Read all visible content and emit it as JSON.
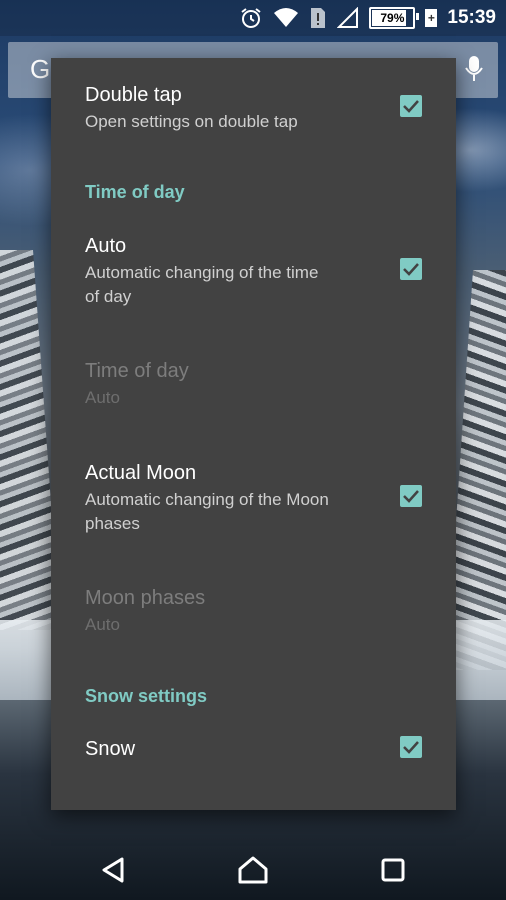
{
  "status_bar": {
    "time": "15:39",
    "battery_percent": "79%",
    "icons": [
      "alarm-icon",
      "wifi-icon",
      "sim-alert-icon",
      "signal-icon",
      "battery-icon"
    ]
  },
  "search_bar": {
    "logo_letter": "G"
  },
  "dialog": {
    "double_tap": {
      "title": "Double tap",
      "summary": "Open settings on double tap",
      "checked": true
    },
    "time_of_day_category": "Time of day",
    "auto": {
      "title": "Auto",
      "summary": "Automatic changing of the time of day",
      "checked": true
    },
    "time_of_day": {
      "title": "Time of day",
      "summary": "Auto",
      "enabled": false
    },
    "actual_moon": {
      "title": "Actual Moon",
      "summary": "Automatic changing of the Moon phases",
      "checked": true
    },
    "moon_phases": {
      "title": "Moon phases",
      "summary": "Auto",
      "enabled": false
    },
    "snow_category": "Snow settings",
    "snow": {
      "title": "Snow",
      "checked": true
    }
  },
  "colors": {
    "accent": "#80cbc4",
    "dialog_bg": "#424242"
  },
  "nav_bar": {
    "buttons": [
      "back-icon",
      "home-icon",
      "recents-icon"
    ]
  }
}
